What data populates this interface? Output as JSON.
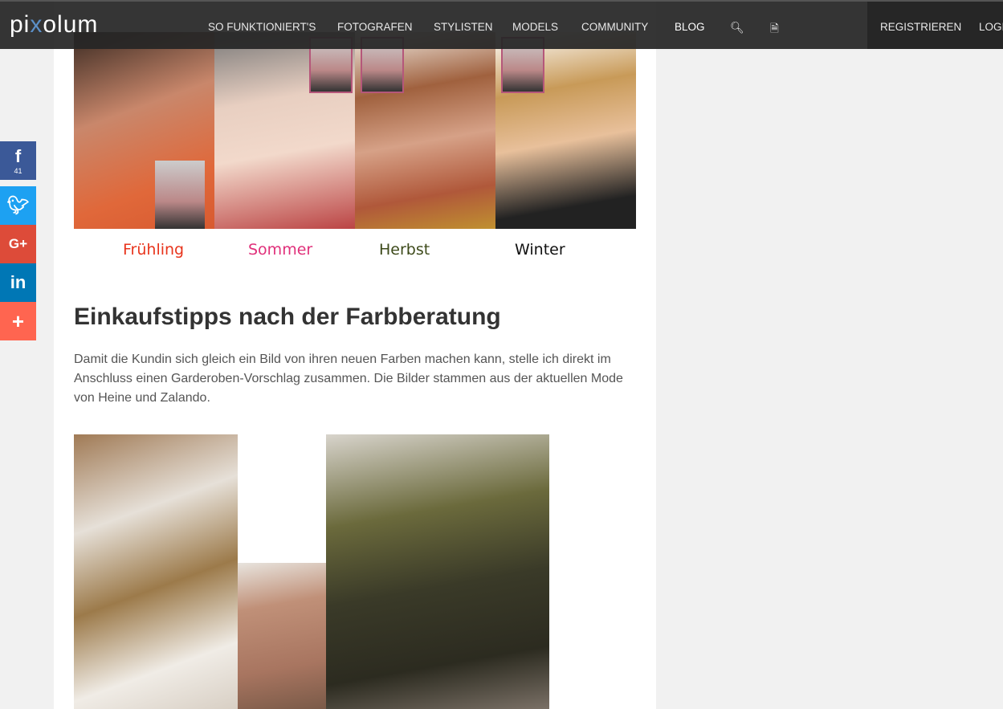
{
  "header": {
    "logo": "pixolum",
    "nav": [
      "SO FUNKTIONIERT'S",
      "FOTOGRAFEN",
      "STYLISTEN",
      "MODELS",
      "COMMUNITY",
      "BLOG"
    ],
    "register": "REGISTRIEREN",
    "login": "LOGIN"
  },
  "social": {
    "facebook_count": "41",
    "colors": {
      "facebook": "#3b5998",
      "twitter": "#1da1f2",
      "google": "#dd4b39",
      "linkedin": "#0077b5",
      "share": "#ff6550"
    }
  },
  "article": {
    "seasons": [
      {
        "label": "Frühling",
        "color": "#e8341c"
      },
      {
        "label": "Sommer",
        "color": "#e0307a"
      },
      {
        "label": "Herbst",
        "color": "#3d4a1a"
      },
      {
        "label": "Winter",
        "color": "#111111"
      }
    ],
    "heading": "Einkaufstipps nach der Farbberatung",
    "paragraph": "Damit die Kundin sich gleich ein Bild von ihren neuen Farben machen kann, stelle ich direkt im Anschluss einen Garderoben-Vorschlag zusammen. Die Bilder stammen aus der aktuellen Mode von Heine und Zalando."
  }
}
